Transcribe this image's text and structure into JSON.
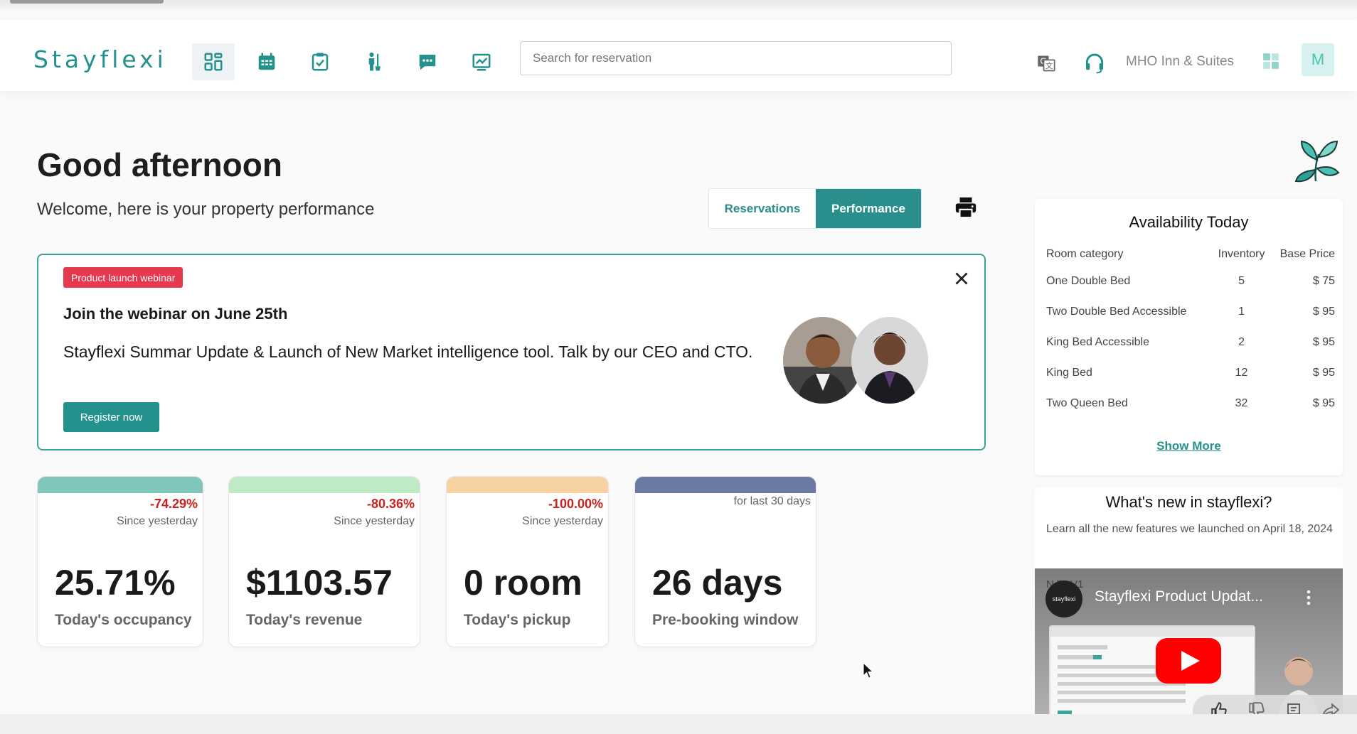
{
  "app": {
    "logo": "Stayflexi"
  },
  "nav": {
    "icons": [
      {
        "name": "dashboard-icon",
        "active": true
      },
      {
        "name": "calendar-icon",
        "active": false
      },
      {
        "name": "tasks-icon",
        "active": false
      },
      {
        "name": "housekeeping-icon",
        "active": false
      },
      {
        "name": "chat-icon",
        "active": false
      },
      {
        "name": "reports-icon",
        "active": false
      }
    ]
  },
  "search": {
    "placeholder": "Search for reservation"
  },
  "header": {
    "hotel_name": "MHO Inn & Suites",
    "avatar_initial": "M"
  },
  "greeting": {
    "title": "Good afternoon",
    "subtitle": "Welcome, here is your property performance"
  },
  "toggle": {
    "reservations": "Reservations",
    "performance": "Performance",
    "active": "Performance"
  },
  "banner": {
    "badge": "Product launch webinar",
    "title": "Join the webinar on June 25th",
    "text": "Stayflexi Summar Update & Launch of New Market intelligence tool. Talk by our CEO and CTO.",
    "button": "Register now"
  },
  "kpis": [
    {
      "delta": "-74.29%",
      "since": "Since yesterday",
      "value": "25.71%",
      "label": "Today's occupancy",
      "color": "#7fc7bb"
    },
    {
      "delta": "-80.36%",
      "since": "Since yesterday",
      "value": "$1103.57",
      "label": "Today's revenue",
      "color": "#bfeac6"
    },
    {
      "delta": "-100.00%",
      "since": "Since yesterday",
      "value": "0 room",
      "label": "Today's pickup",
      "color": "#f6d1a2"
    },
    {
      "delta": "",
      "since": "for last 30 days",
      "value": "26 days",
      "label": "Pre-booking window",
      "color": "#6a7aa3"
    }
  ],
  "availability": {
    "title": "Availability Today",
    "columns": [
      "Room category",
      "Inventory",
      "Base Price"
    ],
    "rows": [
      [
        "One Double Bed",
        "5",
        "$ 75"
      ],
      [
        "Two Double Bed Accessible",
        "1",
        "$ 95"
      ],
      [
        "King Bed Accessible",
        "2",
        "$ 95"
      ],
      [
        "King Bed",
        "12",
        "$ 95"
      ],
      [
        "Two Queen Bed",
        "32",
        "$ 95"
      ]
    ],
    "show_more": "Show More"
  },
  "whats_new": {
    "title": "What's new in stayflexi?",
    "description": "Learn all the new features we launched on April 18, 2024",
    "video_title": "Stayflexi Product Updat...",
    "video_ghost_text": "N      lio V1",
    "channel_name": "stayflexi"
  },
  "colors": {
    "accent": "#24928c",
    "badge": "#e6394e",
    "negative": "#c9211e"
  }
}
